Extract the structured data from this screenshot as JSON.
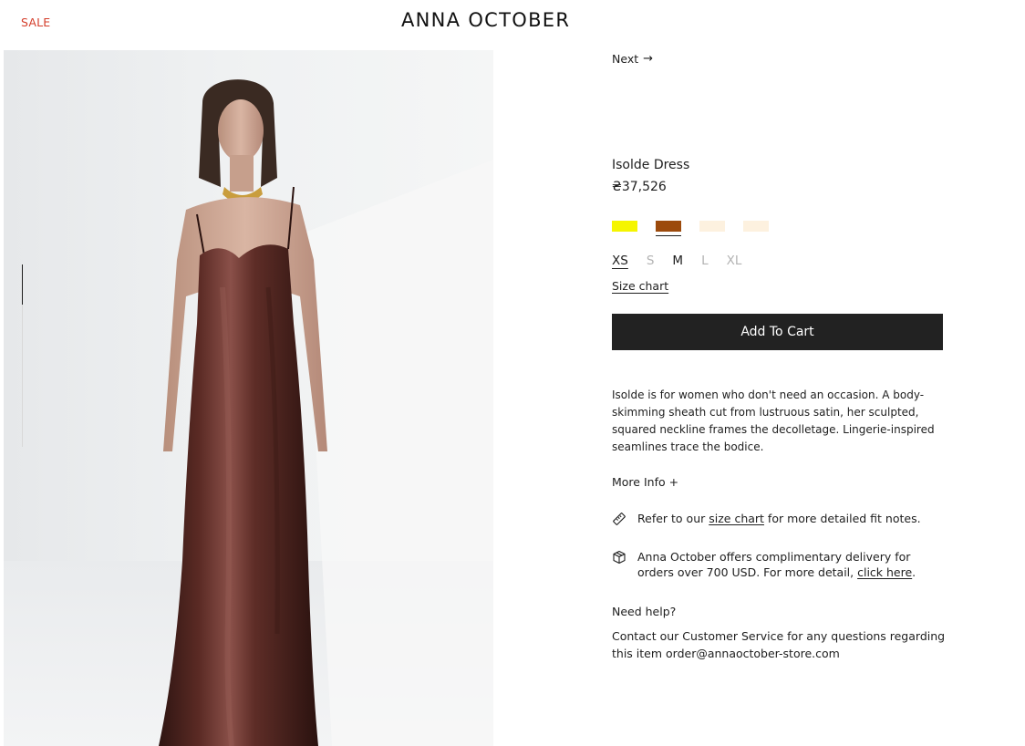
{
  "header": {
    "sale_label": "SALE",
    "brand": "ANNA OCTOBER"
  },
  "navigation": {
    "next_label": "Next",
    "next_icon": "arrow-right-icon"
  },
  "product": {
    "name": "Isolde Dress",
    "price": "₴37,526",
    "colors": [
      {
        "hex": "#f5f500",
        "selected": false
      },
      {
        "hex": "#9c4a0c",
        "selected": true
      },
      {
        "hex": "#fdf1df",
        "selected": false
      },
      {
        "hex": "#fdf1df",
        "selected": false
      }
    ],
    "sizes": [
      {
        "label": "XS",
        "available": true,
        "selected": true
      },
      {
        "label": "S",
        "available": false,
        "selected": false
      },
      {
        "label": "M",
        "available": true,
        "selected": false
      },
      {
        "label": "L",
        "available": false,
        "selected": false
      },
      {
        "label": "XL",
        "available": false,
        "selected": false
      }
    ],
    "size_chart_label": "Size chart",
    "add_to_cart_label": "Add To Cart",
    "description": "Isolde is for women who don't need an occasion. A body-skimming sheath cut from lustruous satin, her sculpted, squared neckline frames the decolletage. Lingerie-inspired seamlines trace the bodice.",
    "more_info_label": "More Info +"
  },
  "notes": {
    "fit": {
      "icon": "ruler-icon",
      "prefix": "Refer to our ",
      "link": "size chart",
      "suffix": " for more detailed fit notes."
    },
    "delivery": {
      "icon": "package-icon",
      "prefix": "Anna October offers complimentary delivery for orders over 700 USD. For more detail, ",
      "link": "click here",
      "suffix": "."
    }
  },
  "help": {
    "title": "Need help?",
    "text": "Contact our Customer Service for any questions regarding this item order@annaoctober-store.com"
  },
  "gallery": {
    "image_subject": "model-in-brown-satin-dress",
    "slide_progress": 0.22
  }
}
